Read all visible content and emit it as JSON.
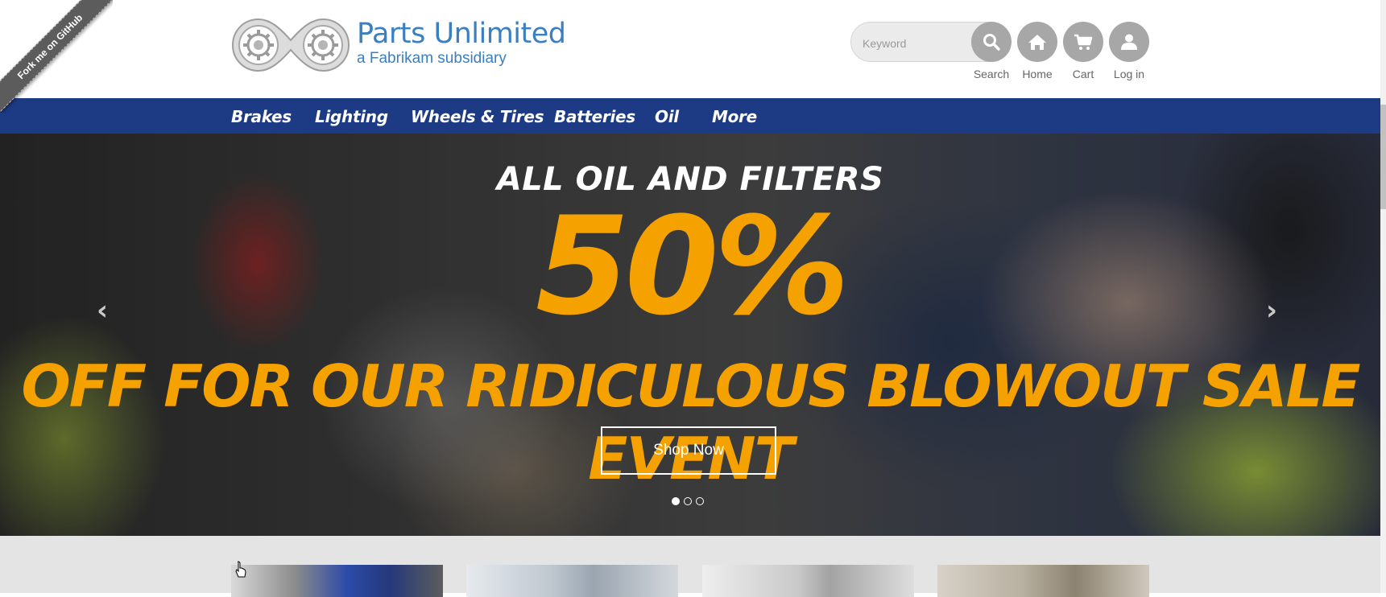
{
  "ribbon": {
    "text": "Fork me on GitHub"
  },
  "brand": {
    "title": "Parts Unlimited",
    "subtitle": "a Fabrikam subsidiary"
  },
  "search": {
    "placeholder": "Keyword",
    "label": "Search"
  },
  "header_icons": [
    {
      "label": "Home",
      "icon": "home-icon"
    },
    {
      "label": "Cart",
      "icon": "cart-icon"
    },
    {
      "label": "Log in",
      "icon": "user-icon"
    }
  ],
  "nav": {
    "items": [
      "Brakes",
      "Lighting",
      "Wheels & Tires",
      "Batteries",
      "Oil",
      "More"
    ]
  },
  "hero": {
    "headline": "ALL OIL AND FILTERS",
    "percent": "50%",
    "offer_line1": "OFF FOR OUR RIDICULOUS BLOWOUT SALE",
    "offer_line2": "EVENT",
    "cta": "Shop Now",
    "slide_count": 3,
    "active_slide": 1
  },
  "colors": {
    "nav_bg": "#1d3a84",
    "accent": "#f5a100",
    "brand_blue": "#3a7fc1",
    "icon_gray": "#a7a7a7"
  }
}
